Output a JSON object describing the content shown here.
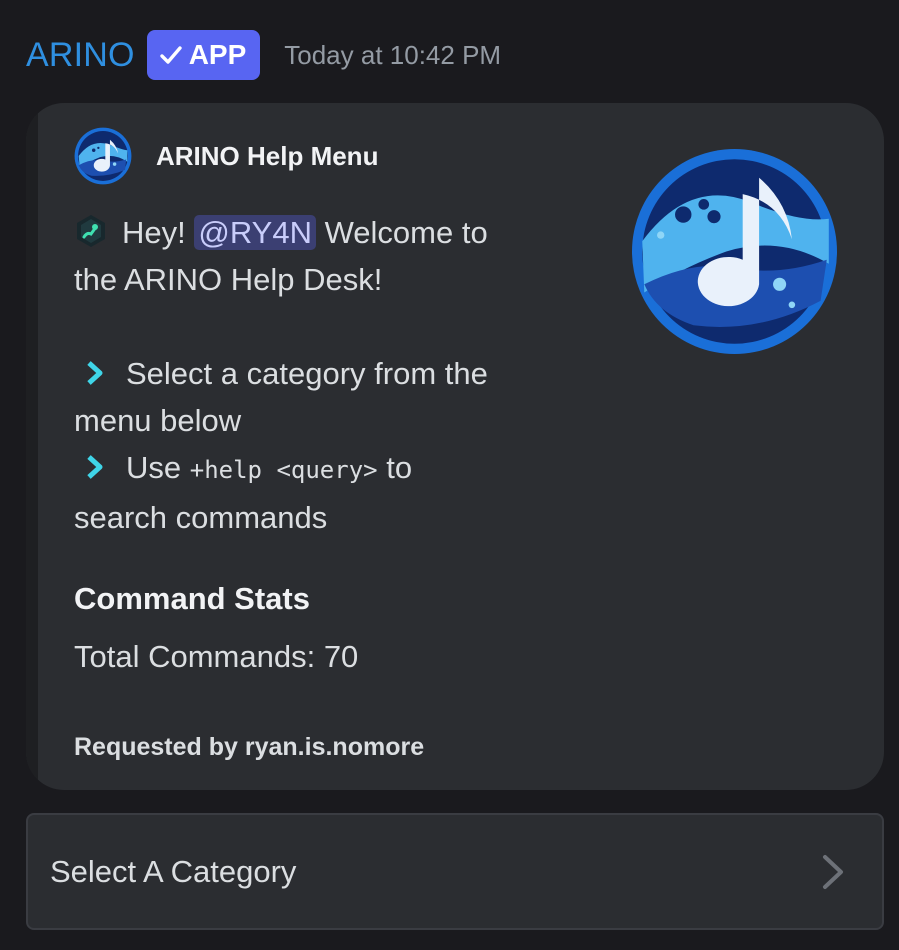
{
  "message": {
    "author": "ARINO",
    "badge_label": "APP",
    "timestamp": "Today at 10:42 PM"
  },
  "embed": {
    "author_title": "ARINO Help Menu",
    "greeting_prefix": "Hey! ",
    "mention": "@RY4N",
    "greeting_suffix": " Welcome to",
    "greeting_line2": "the ARINO Help Desk!",
    "bullet1_line1": "Select a category from the",
    "bullet1_line2": "menu below",
    "bullet2_prefix": "Use ",
    "bullet2_code": "+help <query>",
    "bullet2_suffix": " to",
    "bullet2_line2": "search commands",
    "stats_title": "Command Stats",
    "stats_value": "Total Commands: 70",
    "footer": "Requested by ryan.is.nomore",
    "accent_color": "#1e1f22",
    "mention_bg": "#3b3f72"
  },
  "select_menu": {
    "placeholder": "Select A Category",
    "icon": "chevron-right-icon"
  },
  "colors": {
    "background": "#1a1a1e",
    "author_name": "#2f8fe0",
    "badge_bg": "#5865f2",
    "embed_bg": "#2b2d31",
    "bullet_icon": "#3fd5e8"
  }
}
